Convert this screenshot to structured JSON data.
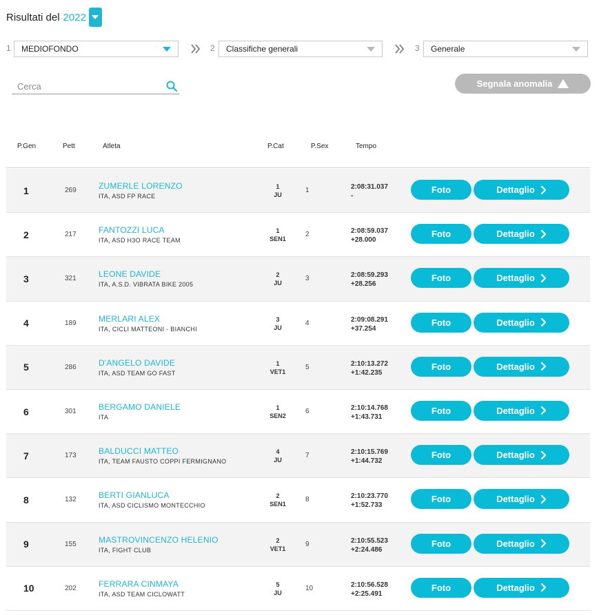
{
  "header": {
    "title": "Risultati del",
    "year": "2022"
  },
  "filters": [
    {
      "step": "1",
      "value": "MEDIOFONDO"
    },
    {
      "step": "2",
      "value": "Classifiche generali"
    },
    {
      "step": "3",
      "value": "Generale"
    }
  ],
  "search": {
    "placeholder": "Cerca"
  },
  "anomaly_button": "Segnala anomalia",
  "columns": {
    "pgen": "P.Gen",
    "pett": "Pett",
    "atleta": "Atleta",
    "pcat": "P.Cat",
    "psex": "P.Sex",
    "tempo": "Tempo"
  },
  "buttons": {
    "foto": "Foto",
    "dettaglio": "Dettaglio"
  },
  "colors": {
    "accent": "#0abbd8",
    "disabled": "#b9b9b9"
  },
  "rows": [
    {
      "pos": "1",
      "pett": "269",
      "name": "ZUMERLE LORENZO",
      "team": "ITA, ASD FP RACE",
      "cat_pos": "1",
      "cat": "JU",
      "psex": "1",
      "time": "2:08:31.037",
      "gap": "-"
    },
    {
      "pos": "2",
      "pett": "217",
      "name": "FANTOZZI LUCA",
      "team": "ITA, ASD H3O RACE TEAM",
      "cat_pos": "1",
      "cat": "SEN1",
      "psex": "2",
      "time": "2:08:59.037",
      "gap": "+28.000"
    },
    {
      "pos": "3",
      "pett": "321",
      "name": "LEONE DAVIDE",
      "team": "ITA, A.S.D. VIBRATA BIKE 2005",
      "cat_pos": "2",
      "cat": "JU",
      "psex": "3",
      "time": "2:08:59.293",
      "gap": "+28.256"
    },
    {
      "pos": "4",
      "pett": "189",
      "name": "MERLARI ALEX",
      "team": "ITA, CICLI MATTEONI - BIANCHI",
      "cat_pos": "3",
      "cat": "JU",
      "psex": "4",
      "time": "2:09:08.291",
      "gap": "+37.254"
    },
    {
      "pos": "5",
      "pett": "286",
      "name": "D'ANGELO DAVIDE",
      "team": "ITA, ASD TEAM GO FAST",
      "cat_pos": "1",
      "cat": "VET1",
      "psex": "5",
      "time": "2:10:13.272",
      "gap": "+1:42.235"
    },
    {
      "pos": "6",
      "pett": "301",
      "name": "BERGAMO DANIELE",
      "team": "ITA",
      "cat_pos": "1",
      "cat": "SEN2",
      "psex": "6",
      "time": "2:10:14.768",
      "gap": "+1:43.731"
    },
    {
      "pos": "7",
      "pett": "173",
      "name": "BALDUCCI MATTEO",
      "team": "ITA, TEAM FAUSTO COPPI FERMIGNANO",
      "cat_pos": "4",
      "cat": "JU",
      "psex": "7",
      "time": "2:10:15.769",
      "gap": "+1:44.732"
    },
    {
      "pos": "8",
      "pett": "132",
      "name": "BERTI GIANLUCA",
      "team": "ITA, ASD CICLISMO MONTECCHIO",
      "cat_pos": "2",
      "cat": "SEN1",
      "psex": "8",
      "time": "2:10:23.770",
      "gap": "+1:52.733"
    },
    {
      "pos": "9",
      "pett": "155",
      "name": "MASTROVINCENZO HELENIO",
      "team": "ITA, FIGHT CLUB",
      "cat_pos": "2",
      "cat": "VET1",
      "psex": "9",
      "time": "2:10:55.523",
      "gap": "+2:24.486"
    },
    {
      "pos": "10",
      "pett": "202",
      "name": "FERRARA CINMAYA",
      "team": "ITA, ASD TEAM CICLOWATT",
      "cat_pos": "5",
      "cat": "JU",
      "psex": "10",
      "time": "2:10:56.528",
      "gap": "+2:25.491"
    }
  ]
}
